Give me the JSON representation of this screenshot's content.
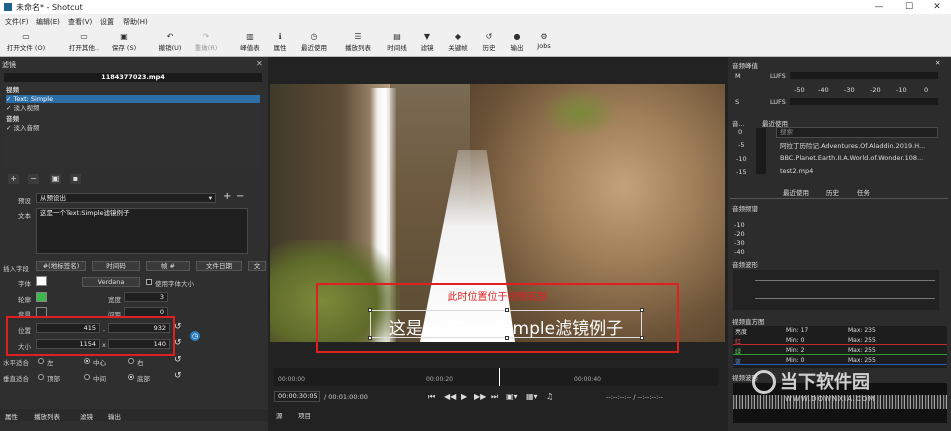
{
  "window": {
    "title": "未命名* - Shotcut",
    "minimize": "—",
    "maximize": "☐",
    "close": "✕"
  },
  "menu": [
    "文件(F)",
    "编辑(E)",
    "查看(V)",
    "设置",
    "帮助(H)"
  ],
  "toolbar": [
    {
      "label": "打开文件 (O)",
      "icon": "▭"
    },
    {
      "label": "打开其他..",
      "icon": "▭"
    },
    {
      "label": "保存 (S)",
      "icon": "▣"
    },
    {
      "label": "撤销(U)",
      "icon": "↶"
    },
    {
      "label": "重做(R)",
      "icon": "↷"
    },
    {
      "label": "峰值表",
      "icon": "▥"
    },
    {
      "label": "属性",
      "icon": "ℹ"
    },
    {
      "label": "最近使用",
      "icon": "◷"
    },
    {
      "label": "播放列表",
      "icon": "☰"
    },
    {
      "label": "时间线",
      "icon": "▤"
    },
    {
      "label": "滤镜",
      "icon": "▼"
    },
    {
      "label": "关键帧",
      "icon": "◆"
    },
    {
      "label": "历史",
      "icon": "↺"
    },
    {
      "label": "输出",
      "icon": "●"
    },
    {
      "label": "Jobs",
      "icon": "⚙"
    }
  ],
  "filters": {
    "panel_title": "滤镜",
    "clip_name": "1184377023.mp4",
    "sections": [
      {
        "header": "视频",
        "items": [
          "Text: Simple",
          "淡入视频"
        ]
      },
      {
        "header": "音频",
        "items": [
          "淡入音频"
        ]
      }
    ],
    "preset_label": "预设",
    "preset_value": "从预设出",
    "text_label": "文本",
    "text_value": "这是一个Text:Simple滤镜例子",
    "insert_label": "插入字段",
    "insert_buttons": [
      "#(地标签名)",
      "时间码",
      "帧 #",
      "文件日期",
      "文"
    ],
    "font_label": "字体",
    "font_name": "Verdana",
    "use_font_size": "使用字体大小",
    "outline_label": "轮廓",
    "thickness_label": "宽度",
    "thickness_value": "3",
    "bg_label": "背景",
    "padding_label": "间距",
    "padding_value": "0",
    "pos_label": "位置",
    "pos_x": "415",
    "pos_y": "932",
    "size_label": "大小",
    "size_w": "1154",
    "size_h": "140",
    "halign_label": "水平适合",
    "halign_opts": [
      "左",
      "中心",
      "右"
    ],
    "valign_label": "垂直适合",
    "valign_opts": [
      "顶部",
      "中间",
      "底部"
    ]
  },
  "left_tabs": [
    "属性",
    "播放列表",
    "滤镜",
    "输出"
  ],
  "viewer": {
    "annotation": "此时位置位于视频底部",
    "overlay_text": "这是一个Text:Simple滤镜例子",
    "ticks": [
      "00:00:00",
      "00:00:20",
      "00:00:40"
    ],
    "timecode": "00:00:30:05",
    "duration": "/ 00:01:00:00",
    "source_tab": "源",
    "project_tab": "项目",
    "inout": "--:--:--:-- /   --:--:--:--"
  },
  "right": {
    "peak_title": "音频峰值",
    "peak_scale": [
      "-50",
      "-40",
      "-30",
      "-20",
      "-10",
      "0"
    ],
    "recent_title": "最近使用",
    "search_placeholder": "搜索",
    "recent_items": [
      "阿拉丁历险记.Adventures.Of.Aladdin.2019.H...",
      "BBC.Planet.Earth.II.A.World.of.Wonder.108...",
      "test2.mp4"
    ],
    "recent_tabs": [
      "最近使用",
      "历史",
      "任务"
    ],
    "db_scale": [
      "0",
      "-5",
      "-10",
      "-15"
    ],
    "spectrum_title": "音频频谱",
    "spectrum_scale": [
      "-10",
      "-20",
      "-30",
      "-40"
    ],
    "waveform_title": "音频波形",
    "histogram_title": "视频直方图",
    "histogram_rows": [
      {
        "name": "亮度",
        "min": "Min: 17",
        "max": "Max: 235"
      },
      {
        "name": "红",
        "min": "Min: 0",
        "max": "Max: 255"
      },
      {
        "name": "绿",
        "min": "Min: 2",
        "max": "Max: 255"
      },
      {
        "name": "蓝",
        "min": "Min: 0",
        "max": "Max: 255"
      }
    ],
    "vwave_title": "视频波形",
    "watermark": "当下软件园",
    "watermark_sub": "WWW.DOWNXIA.COM"
  }
}
